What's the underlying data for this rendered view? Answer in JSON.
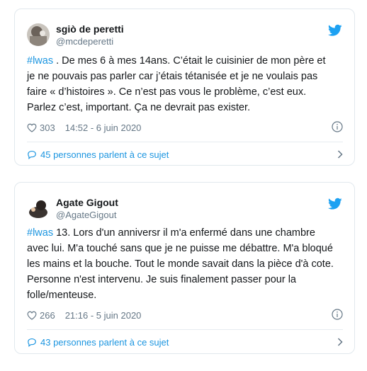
{
  "tweets": [
    {
      "author": "sgiò de peretti",
      "handle": "@mcdeperetti",
      "hashtag": "#lwas",
      "lines": [
        " . De mes 6 à mes 14ans. C’était le cuisinier de mon père et",
        "je ne pouvais pas parler car j’étais tétanisée et je ne voulais pas",
        "faire « d’histoires ». Ce n’est pas vous le problème, c’est eux.",
        "Parlez c’est, important. Ça ne devrait pas exister."
      ],
      "likes": "303",
      "timestamp": "14:52 - 6 juin 2020",
      "conversation": "45 personnes parlent à ce sujet"
    },
    {
      "author": "Agate Gigout",
      "handle": "@AgateGigout",
      "hashtag": "#lwas",
      "lines": [
        " 13. Lors d'un anniversr il m'a enfermé dans une chambre",
        "avec lui. M'a touché sans que je ne puisse me débattre. M'a bloqué",
        "les mains et la bouche. Tout le monde savait dans la pièce d'à cote.",
        "Personne n'est intervenu. Je suis finalement passer pour la",
        "folle/menteuse."
      ],
      "likes": "266",
      "timestamp": "21:16 - 5 juin 2020",
      "conversation": "43 personnes parlent à ce sujet"
    }
  ],
  "colors": {
    "link": "#1b95e0",
    "text": "#14171a",
    "secondary": "#657786",
    "border": "#e1e8ed",
    "twitter_blue": "#1da1f2"
  },
  "icons": [
    "twitter-bird-icon",
    "heart-icon",
    "info-icon",
    "reply-bubble-icon",
    "chevron-right-icon"
  ]
}
